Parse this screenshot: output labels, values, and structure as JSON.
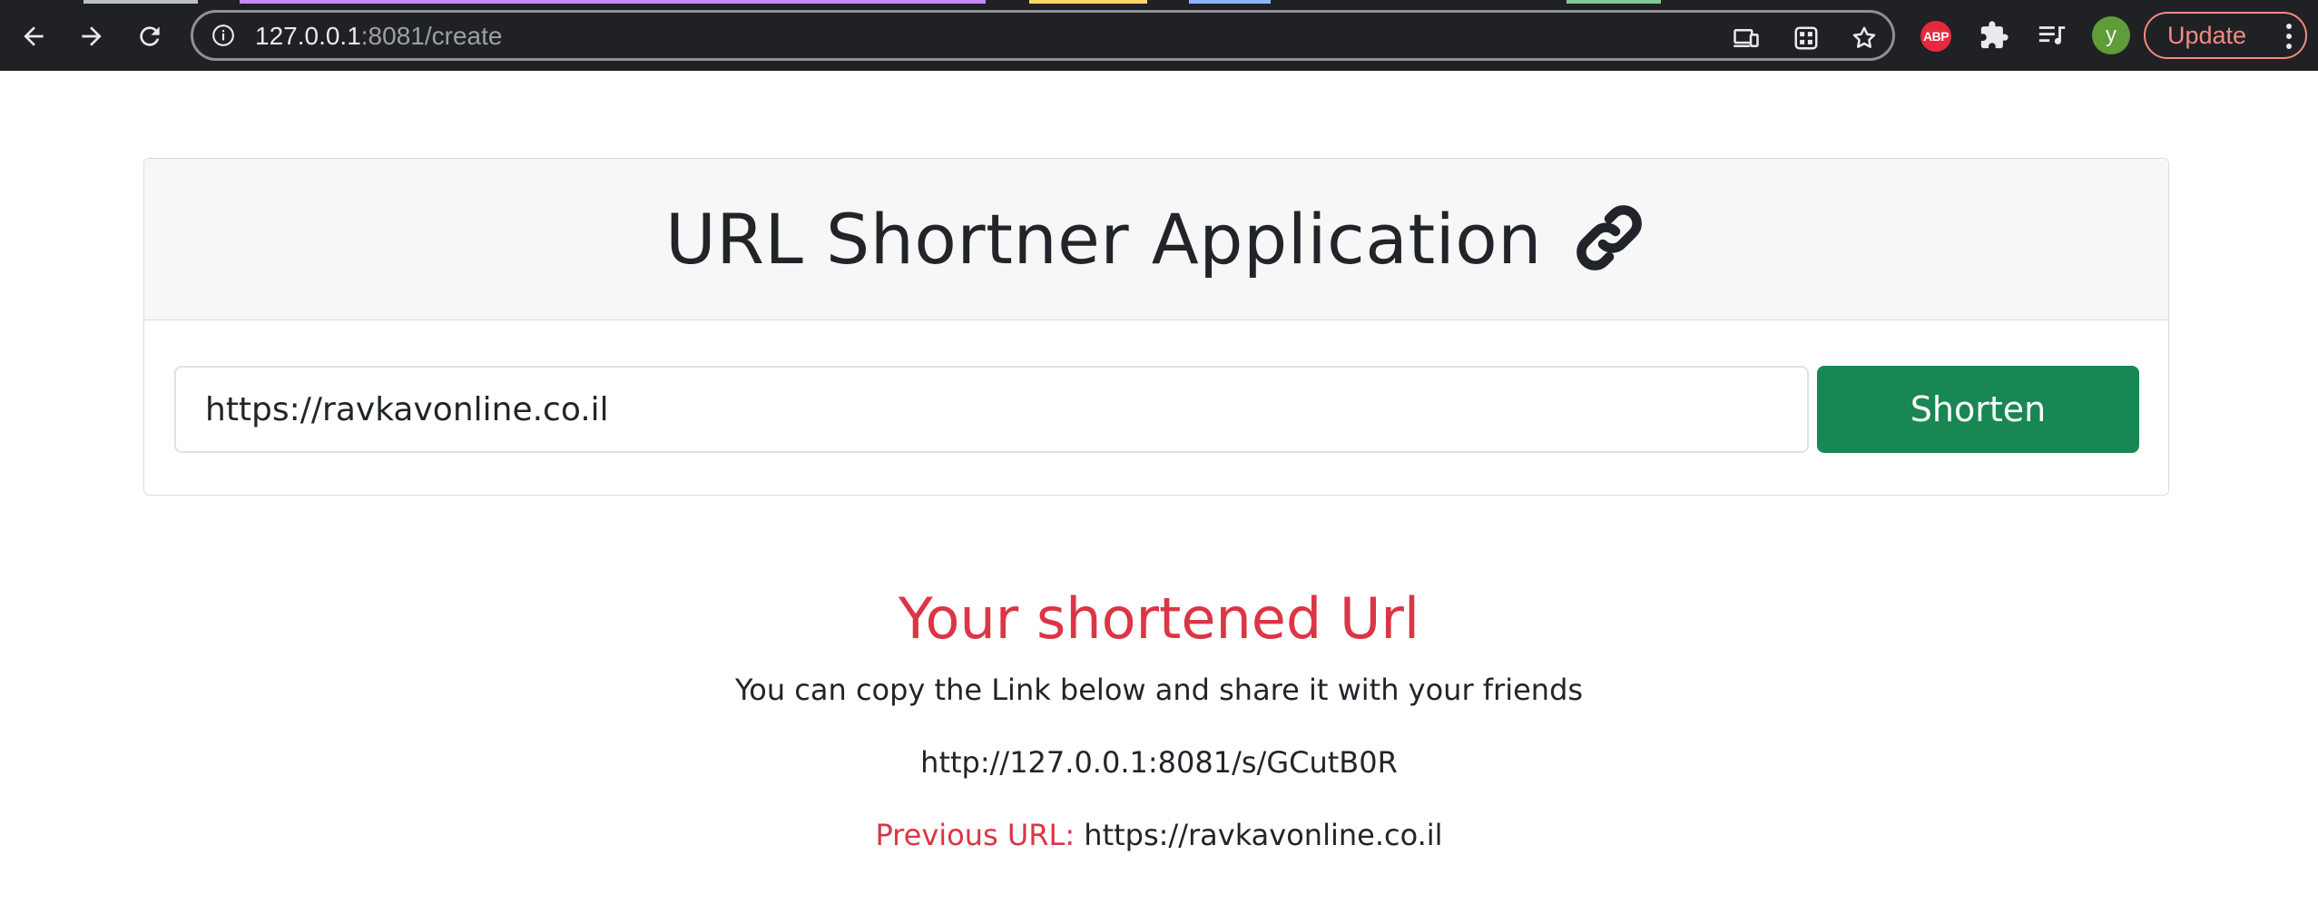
{
  "browser": {
    "url_host": "127.0.0.1",
    "url_path": ":8081/create",
    "update_label": "Update",
    "avatar_letter": "y",
    "abp_label": "ABP",
    "tab_colors": [
      "#bdc1c6",
      "#c58af9",
      "#fdd663",
      "#8ab4f8",
      "#81c995"
    ]
  },
  "page": {
    "title": "URL Shortner Application",
    "input_value": "https://ravkavonline.co.il",
    "shorten_label": "Shorten",
    "result_heading": "Your shortened Url",
    "result_subtext": "You can copy the Link below and share it with your friends",
    "short_url": "http://127.0.0.1:8081/s/GCutB0R",
    "previous_label": "Previous URL:",
    "previous_value": "https://ravkavonline.co.il"
  },
  "colors": {
    "accent_green": "#198754",
    "danger_red": "#dc3545"
  }
}
